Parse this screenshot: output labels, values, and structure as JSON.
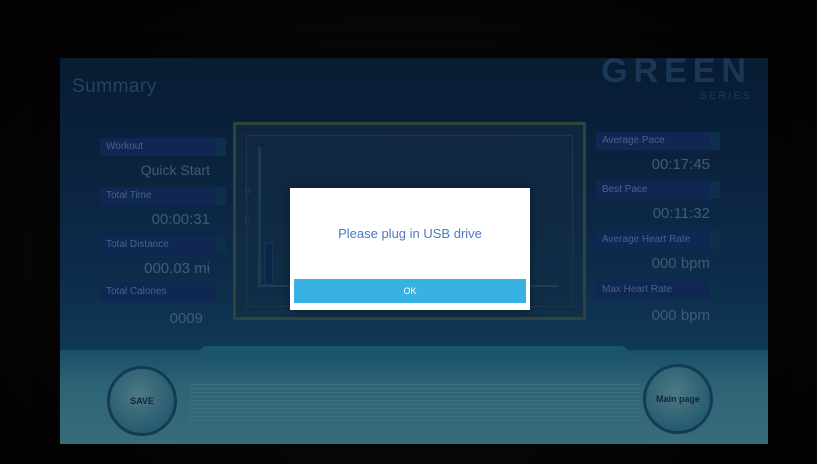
{
  "header": {
    "title": "Summary",
    "brand_main": "GREEN",
    "brand_sub": "SERIES"
  },
  "left_stats": [
    {
      "label": "Workout",
      "value": "Quick Start"
    },
    {
      "label": "Total Time",
      "value": "00:00:31"
    },
    {
      "label": "Total Distance",
      "value": "000.03 mi"
    },
    {
      "label": "Total Calories",
      "value": "0009"
    }
  ],
  "right_stats": [
    {
      "label": "Average Pace",
      "value": "00:17:45"
    },
    {
      "label": "Best Pace",
      "value": "00:11:32"
    },
    {
      "label": "Average Heart Rate",
      "value": "000 bpm"
    },
    {
      "label": "Max Heart Rate",
      "value": "000 bpm"
    }
  ],
  "graph": {
    "tick_top": "15",
    "tick_mid": "10"
  },
  "buttons": {
    "save": "SAVE",
    "main_page": "Main page"
  },
  "dialog": {
    "message": "Please plug in USB drive",
    "ok": "OK"
  },
  "colors": {
    "accent": "#38b1e3",
    "message": "#4b79c2"
  }
}
